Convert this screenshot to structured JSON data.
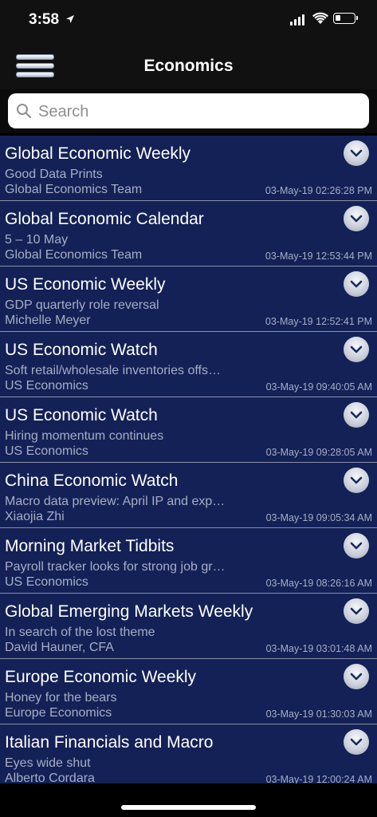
{
  "status": {
    "time": "3:58"
  },
  "nav": {
    "title": "Economics"
  },
  "search": {
    "placeholder": "Search"
  },
  "items": [
    {
      "title": "Global Economic Weekly",
      "subtitle": "Good Data Prints",
      "author": "Global Economics Team",
      "date": "03-May-19 02:26:28 PM"
    },
    {
      "title": "Global Economic Calendar",
      "subtitle": "5 – 10 May",
      "author": "Global Economics Team",
      "date": "03-May-19 12:53:44 PM"
    },
    {
      "title": "US Economic Weekly",
      "subtitle": "GDP quarterly role reversal",
      "author": "Michelle Meyer",
      "date": "03-May-19 12:52:41 PM"
    },
    {
      "title": "US Economic Watch",
      "subtitle": "Soft retail/wholesale inventories offs…",
      "author": "US Economics",
      "date": "03-May-19 09:40:05 AM"
    },
    {
      "title": "US Economic Watch",
      "subtitle": "Hiring momentum continues",
      "author": "US Economics",
      "date": "03-May-19 09:28:05 AM"
    },
    {
      "title": "China Economic Watch",
      "subtitle": "Macro data preview: April IP and exp…",
      "author": "Xiaojia Zhi",
      "date": "03-May-19 09:05:34 AM"
    },
    {
      "title": "Morning Market Tidbits",
      "subtitle": "Payroll tracker looks for strong job gr…",
      "author": "US Economics",
      "date": "03-May-19 08:26:16 AM"
    },
    {
      "title": "Global Emerging Markets Weekly",
      "subtitle": "In search of the lost theme",
      "author": "David Hauner, CFA",
      "date": "03-May-19 03:01:48 AM"
    },
    {
      "title": "Europe Economic Weekly",
      "subtitle": "Honey for the bears",
      "author": "Europe Economics",
      "date": "03-May-19 01:30:03 AM"
    },
    {
      "title": "Italian Financials and Macro",
      "subtitle": "Eyes wide shut",
      "author": "Alberto Cordara",
      "date": "03-May-19 12:00:24 AM"
    }
  ]
}
